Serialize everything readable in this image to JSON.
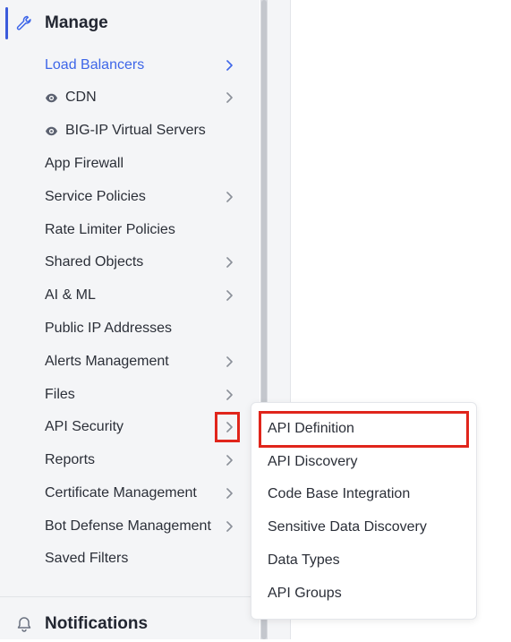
{
  "sidebar": {
    "manage": {
      "label": "Manage",
      "icon": "wrench-icon"
    },
    "items": [
      {
        "label": "Load Balancers",
        "active": true,
        "chevron": true,
        "icon": null
      },
      {
        "label": "CDN",
        "active": false,
        "chevron": true,
        "icon": "eye-icon"
      },
      {
        "label": "BIG-IP Virtual Servers",
        "active": false,
        "chevron": false,
        "icon": "eye-icon"
      },
      {
        "label": "App Firewall",
        "active": false,
        "chevron": false,
        "icon": null
      },
      {
        "label": "Service Policies",
        "active": false,
        "chevron": true,
        "icon": null
      },
      {
        "label": "Rate Limiter Policies",
        "active": false,
        "chevron": false,
        "icon": null
      },
      {
        "label": "Shared Objects",
        "active": false,
        "chevron": true,
        "icon": null
      },
      {
        "label": "AI & ML",
        "active": false,
        "chevron": true,
        "icon": null
      },
      {
        "label": "Public IP Addresses",
        "active": false,
        "chevron": false,
        "icon": null
      },
      {
        "label": "Alerts Management",
        "active": false,
        "chevron": true,
        "icon": null
      },
      {
        "label": "Files",
        "active": false,
        "chevron": true,
        "icon": null
      },
      {
        "label": "API Security",
        "active": false,
        "chevron": true,
        "icon": null
      },
      {
        "label": "Reports",
        "active": false,
        "chevron": true,
        "icon": null
      },
      {
        "label": "Certificate Management",
        "active": false,
        "chevron": true,
        "icon": null
      },
      {
        "label": "Bot Defense Management",
        "active": false,
        "chevron": true,
        "icon": null
      },
      {
        "label": "Saved Filters",
        "active": false,
        "chevron": false,
        "icon": null
      }
    ],
    "notifications": {
      "label": "Notifications",
      "icon": "bell-icon"
    }
  },
  "submenu": {
    "items": [
      {
        "label": "API Definition"
      },
      {
        "label": "API Discovery"
      },
      {
        "label": "Code Base Integration"
      },
      {
        "label": "Sensitive Data Discovery"
      },
      {
        "label": "Data Types"
      },
      {
        "label": "API Groups"
      }
    ]
  },
  "colors": {
    "accent": "#3e66e8",
    "highlight": "#e0251b",
    "sidebar_bg": "#f4f5f7"
  }
}
